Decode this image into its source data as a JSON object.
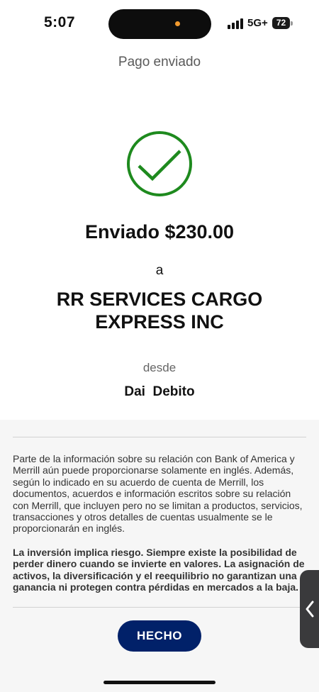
{
  "status_bar": {
    "time": "5:07",
    "network": "5G+",
    "battery": "72"
  },
  "header": {
    "title": "Pago enviado"
  },
  "confirmation": {
    "icon": "checkmark-circle-icon",
    "success_color": "#1e8a1e",
    "sent_amount": "Enviado $230.00",
    "to_label": "a",
    "recipient": "RR SERVICES CARGO EXPRESS INC",
    "from_label": "desde",
    "account": "Dai  Debito"
  },
  "disclosure": {
    "language_notice": "Parte de la información sobre su relación con Bank of America y Merrill aún puede proporcionarse solamente en inglés. Además, según lo indicado en su acuerdo de cuenta de Merrill, los documentos, acuerdos e información escritos sobre su relación con Merrill, que incluyen pero no se limitan a productos, servicios, transacciones y otros detalles de cuentas usualmente se le proporcionarán en inglés.",
    "risk_notice": "La inversión implica riesgo. Siempre existe la posibilidad de perder dinero cuando se invierte en valores. La asignación de activos, la diversificación y el reequilibrio no garantizan una ganancia ni protegen contra pérdidas en mercados a la baja."
  },
  "actions": {
    "done_label": "HECHO",
    "button_color": "#012169"
  },
  "side_handle": {
    "icon": "chevron-left-icon"
  }
}
